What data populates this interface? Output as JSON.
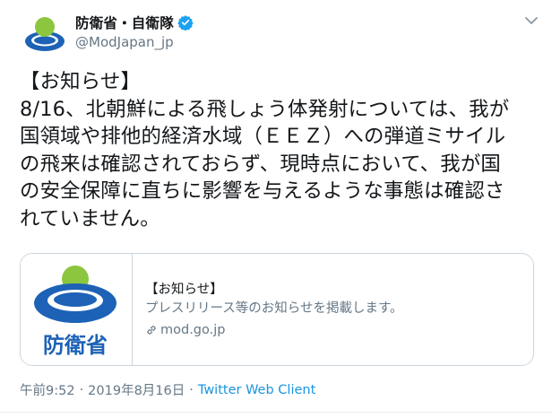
{
  "author": {
    "display_name": "防衛省・自衛隊",
    "handle": "@ModJapan_jp",
    "verified": true,
    "avatar_icon": "mod-logo-icon"
  },
  "tweet": {
    "lines": [
      "【お知らせ】",
      "8/16、北朝鮮による飛しょう体発射については、我が",
      "国領域や排他的経済水域（ＥＥＺ）への弾道ミサイル",
      "の飛来は確認されておらず、現時点において、我が国",
      "の安全保障に直ちに影響を与えるような事態は確認さ",
      "れていません。"
    ]
  },
  "card": {
    "image_caption": "防衛省",
    "title": "【お知らせ】",
    "description": "プレスリリース等のお知らせを掲載します。",
    "domain": "mod.go.jp"
  },
  "meta": {
    "time": "午前9:52",
    "separator": "·",
    "date": "2019年8月16日",
    "source": "Twitter Web Client"
  },
  "colors": {
    "logo_green": "#8cc63f",
    "logo_blue": "#1d62b6",
    "link_blue": "#1b95e0",
    "verified_blue": "#1da1f2",
    "muted_gray": "#657786"
  }
}
